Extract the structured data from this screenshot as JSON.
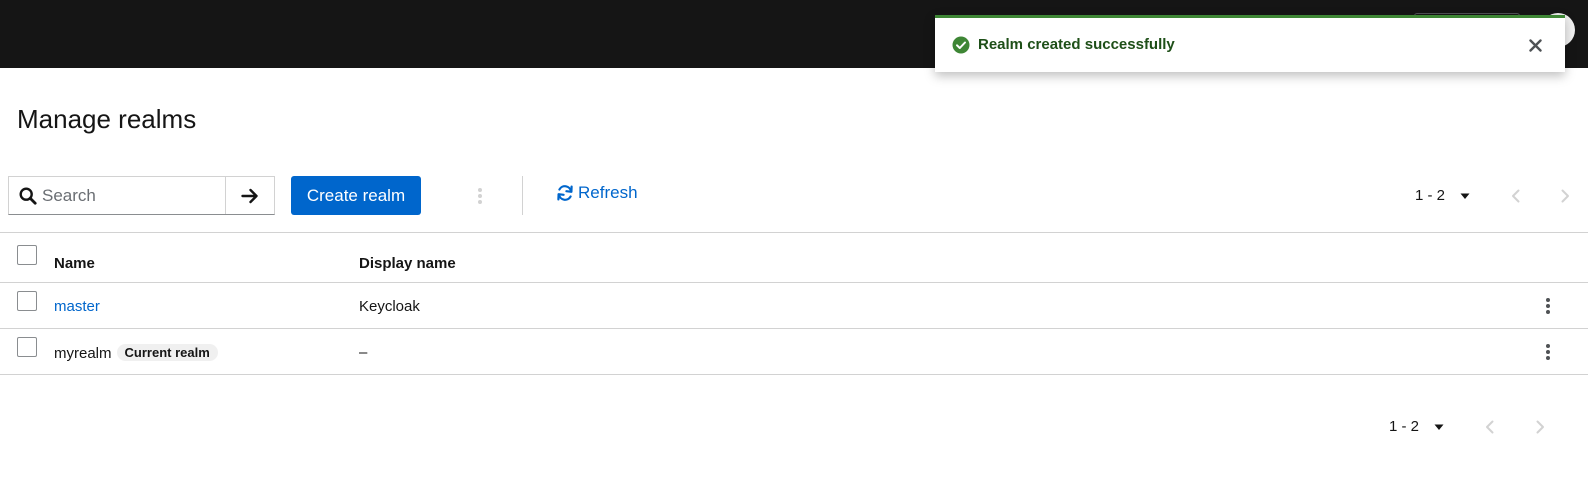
{
  "toast": {
    "title": "Realm created successfully",
    "variant_color": "#3e8635",
    "icon": "check-circle-icon",
    "close_icon": "close-icon"
  },
  "page": {
    "title": "Manage realms"
  },
  "toolbar": {
    "search_placeholder": "Search",
    "search_go_icon": "arrow-right-icon",
    "create_label": "Create realm",
    "refresh_label": "Refresh",
    "pagination_label": "1 - 2"
  },
  "table": {
    "columns": [
      "Name",
      "Display name"
    ],
    "rows": [
      {
        "name": "master",
        "display_name": "Keycloak",
        "badge": ""
      },
      {
        "name": "myrealm",
        "display_name": "–",
        "badge": "Current realm"
      }
    ]
  },
  "footer": {
    "pagination_label": "1 - 2"
  },
  "colors": {
    "masthead": "#151515",
    "primary": "#0066cc",
    "success": "#3e8635"
  }
}
